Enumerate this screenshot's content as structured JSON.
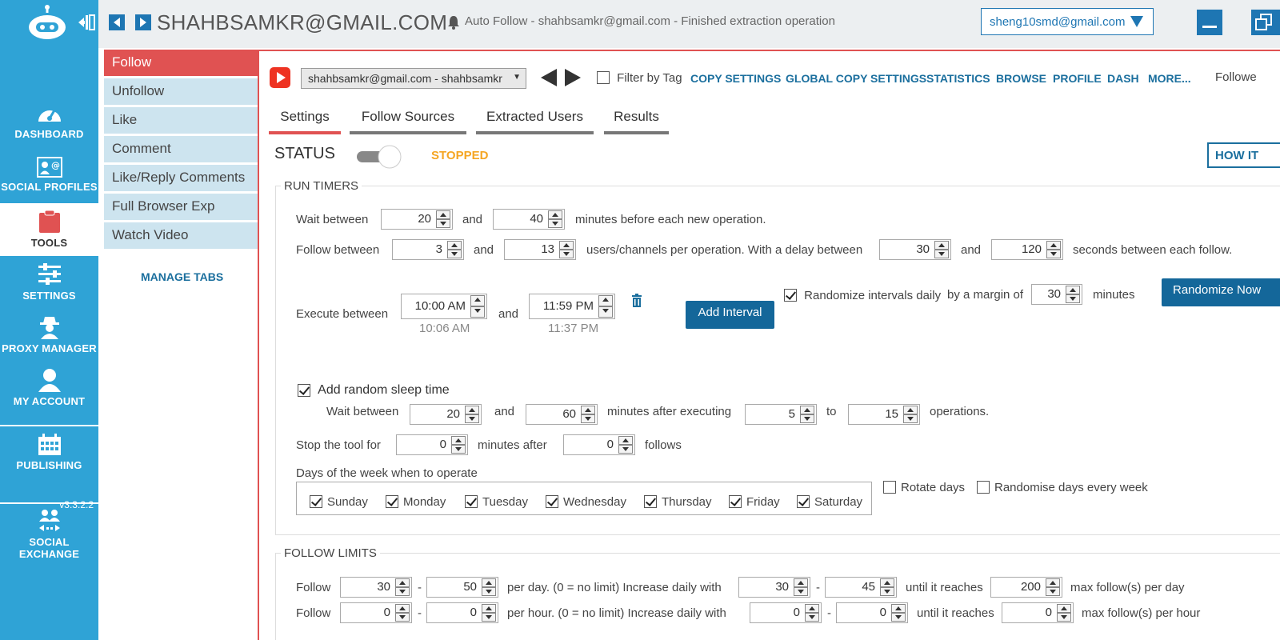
{
  "sidebar": {
    "items": [
      {
        "label": "DASHBOARD",
        "icon": "dashboard-icon"
      },
      {
        "label": "SOCIAL PROFILES",
        "icon": "social-profiles-icon"
      },
      {
        "label": "TOOLS",
        "icon": "tools-icon"
      },
      {
        "label": "SETTINGS",
        "icon": "settings-icon"
      },
      {
        "label": "PROXY MANAGER",
        "icon": "proxy-manager-icon"
      },
      {
        "label": "MY ACCOUNT",
        "icon": "account-icon"
      },
      {
        "label": "PUBLISHING",
        "icon": "publishing-icon"
      },
      {
        "label": "SOCIAL EXCHANGE",
        "icon": "social-exchange-icon"
      }
    ],
    "version": "v3.3.2.2"
  },
  "header": {
    "account_title": "SHAHBSAMKR@GMAIL.COM",
    "status_message": "Auto Follow - shahbsamkr@gmail.com - Finished extraction operation",
    "user_select": "sheng10smd@gmail.com"
  },
  "tool_tabs": [
    "Follow",
    "Unfollow",
    "Like",
    "Comment",
    "Like/Reply Comments",
    "Full Browser Exp",
    "Watch Video"
  ],
  "manage_tabs": "MANAGE TABS",
  "toolbar": {
    "account_dropdown": "shahbsamkr@gmail.com - shahbsamkr",
    "filter_by_tag": "Filter by Tag",
    "links": [
      "COPY SETTINGS",
      "GLOBAL COPY SETTINGS",
      "STATISTICS",
      "BROWSE",
      "PROFILE",
      "DASH",
      "MORE..."
    ],
    "followers_cut": "Followe"
  },
  "sub_tabs": [
    "Settings",
    "Follow Sources",
    "Extracted Users",
    "Results"
  ],
  "status": {
    "label": "STATUS",
    "value": "STOPPED",
    "how_it": "HOW IT"
  },
  "run_timers": {
    "title": "RUN TIMERS",
    "wait_between": "Wait between",
    "and": "and",
    "wait_min": "20",
    "wait_max": "40",
    "wait_suffix": "minutes before each new operation.",
    "follow_between": "Follow between",
    "follow_min": "3",
    "follow_max": "13",
    "follow_suffix": "users/channels per operation.  With a delay between",
    "delay_min": "30",
    "delay_max": "120",
    "delay_suffix": "seconds between each follow.",
    "execute_between": "Execute between",
    "exec_start": "10:00 AM",
    "exec_end": "11:59 PM",
    "exec_start_actual": "10:06 AM",
    "exec_end_actual": "11:37 PM",
    "add_interval": "Add Interval",
    "randomize_intervals": "Randomize intervals daily",
    "by_margin": "by a margin of",
    "margin": "30",
    "minutes": "minutes",
    "randomize_now": "Randomize Now",
    "add_random_sleep": "Add random sleep time",
    "sleep_wait_between": "Wait between",
    "sleep_min": "20",
    "sleep_max": "60",
    "after_executing": "minutes after executing",
    "ops_min": "5",
    "to": "to",
    "ops_max": "15",
    "operations": "operations.",
    "stop_tool_for": "Stop the tool for",
    "stop_minutes": "0",
    "minutes_after": "minutes after",
    "stop_follows": "0",
    "follows": "follows",
    "days_label": "Days of the week when to operate",
    "days": [
      "Sunday",
      "Monday",
      "Tuesday",
      "Wednesday",
      "Thursday",
      "Friday",
      "Saturday"
    ],
    "rotate_days": "Rotate days",
    "randomise_days": "Randomise days every week"
  },
  "follow_limits": {
    "title": "FOLLOW LIMITS",
    "row1": {
      "label": "Follow",
      "min": "30",
      "dash": "-",
      "max": "50",
      "mid": "per day. (0 = no limit)  Increase daily with",
      "inc_min": "30",
      "inc_max": "45",
      "until": "until it reaches",
      "reach": "200",
      "suffix": "max follow(s) per day"
    },
    "row2": {
      "label": "Follow",
      "min": "0",
      "dash": "-",
      "max": "0",
      "mid": "per hour. (0 = no limit)  Increase daily with",
      "inc_min": "0",
      "inc_max": "0",
      "until": "until it reaches",
      "reach": "0",
      "suffix": "max follow(s) per hour"
    }
  },
  "colors": {
    "sidebar": "#2fa3d6",
    "accent_red": "#e05252",
    "link_blue": "#1b6f9e",
    "status_orange": "#f5a623"
  }
}
